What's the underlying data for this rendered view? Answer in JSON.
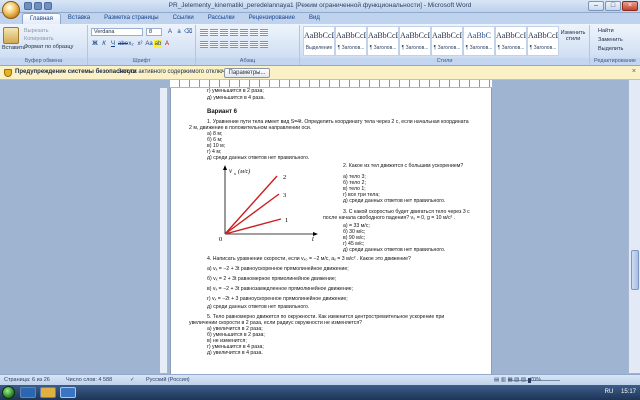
{
  "window": {
    "title": "PR_Jelementy_kinematiki_peredelannaya1 [Режим ограниченной функциональности] - Microsoft Word"
  },
  "tabs": [
    "Главная",
    "Вставка",
    "Разметка страницы",
    "Ссылки",
    "Рассылки",
    "Рецензирование",
    "Вид"
  ],
  "ribbon": {
    "clipboard": {
      "paste": "Вставить",
      "cut": "Вырезать",
      "copy": "Копировать",
      "format": "Формат по образцу",
      "label": "Буфер обмена"
    },
    "font": {
      "name": "Verdana",
      "size": "8",
      "label": "Шрифт"
    },
    "paragraph_label": "Абзац",
    "styles": [
      {
        "preview": "AaBbCcDc",
        "name": "Выделение"
      },
      {
        "preview": "AaBbCcDc",
        "name": "¶ Заголов..."
      },
      {
        "preview": "AaBbCcDc",
        "name": "¶ Заголов..."
      },
      {
        "preview": "AaBbCcDc",
        "name": "¶ Заголов..."
      },
      {
        "preview": "AaBbCcDc",
        "name": "¶ Заголов..."
      },
      {
        "preview": "AaBbC",
        "name": "¶ Заголов..."
      },
      {
        "preview": "AaBbCcI",
        "name": "¶ Заголов..."
      },
      {
        "preview": "AaBbCcDc",
        "name": "¶ Заголов..."
      },
      {
        "preview": "AaBbC",
        "name": "Название"
      }
    ],
    "styles_label": "Стили",
    "change_styles": "Изменить стили",
    "editing": {
      "find": "Найти",
      "replace": "Заменить",
      "select": "Выделить",
      "label": "Редактирование"
    }
  },
  "security_bar": {
    "title": "Предупреждение системы безопасности",
    "message": "Запуск активного содержимого отключен.",
    "button": "Параметры..."
  },
  "document": {
    "top_lines": [
      "г) уменьшится в 2 раза;",
      "д) уменьшится в 4 раза."
    ],
    "variant": "Вариант 6",
    "q1": [
      "1. Уравнение пути тела имеет вид S=4t. Определить координату тела через 2 с, если начальная координата",
      "2 м, движение в положительном направлении оси.",
      "а) 8 м;",
      "б) 6 м;",
      "в) 10 м;",
      "г) 4 м;",
      "д) среди данных ответов нет правильного."
    ],
    "chart_ylabel": "v",
    "chart_ylabel_sub": "x",
    "chart_yunit": "(м/с)",
    "chart_xlabel": "t",
    "chart_origin": "0",
    "chart_lines": [
      "1",
      "2",
      "3"
    ],
    "q2": [
      "2. Какое из тел движется с большим ускорением?",
      "а) тело 3;",
      "б) тело 2;",
      "в) тело 1;",
      "г) все три тела;",
      "д) среди данных ответов нет правильного."
    ],
    "q3": [
      "3. С какой скоростью будет двигаться тело через 3 с",
      "после начала свободного падения? v₀ = 0,  g = 10 м/с² .",
      "а) = 33 м/с;",
      "б) 30 м/с;",
      "в) 90 м/с;",
      "г) 45 м/с;",
      "д) среди данных ответов нет правильного."
    ],
    "q4": [
      "4. Написать уравнение скорости, если  vₓ₀ = −2 м/с,  aₓ = 3 м/с² . Какое это движение?",
      "а)  vₓ = −2 + 3t  равноускоренное прямолинейное движение;",
      "б)  vₓ = 2 + 3t  равномерное прямолинейное движение;",
      "в)  vₓ = −2 + 3t  равнозамедленное прямолинейное движение;",
      "г)  vₓ = −2t + 3  равноускоренное прямолинейное движение;",
      "д) среди данных ответов нет правильного."
    ],
    "q5": [
      "5. Тело равномерно движется по окружности. Как изменится центростремительное ускорение при",
      "увеличении скорости в 2 раза, если радиус окружности не изменяется?",
      "а) увеличится в 2 раза;",
      "б) уменьшится в 2 раза;",
      "в) не изменится;",
      "г) уменьшится в 4 раза;",
      "д) увеличится в 4 раза."
    ]
  },
  "status": {
    "page": "Страница: 6 из 26",
    "words": "Число слов: 4 588",
    "language": "Русский (Россия)",
    "zoom": "70%"
  },
  "taskbar": {
    "lang": "RU",
    "time": "15:17"
  },
  "colors": {
    "chart_line": "#cc1f1f",
    "accent": "#15428b"
  }
}
